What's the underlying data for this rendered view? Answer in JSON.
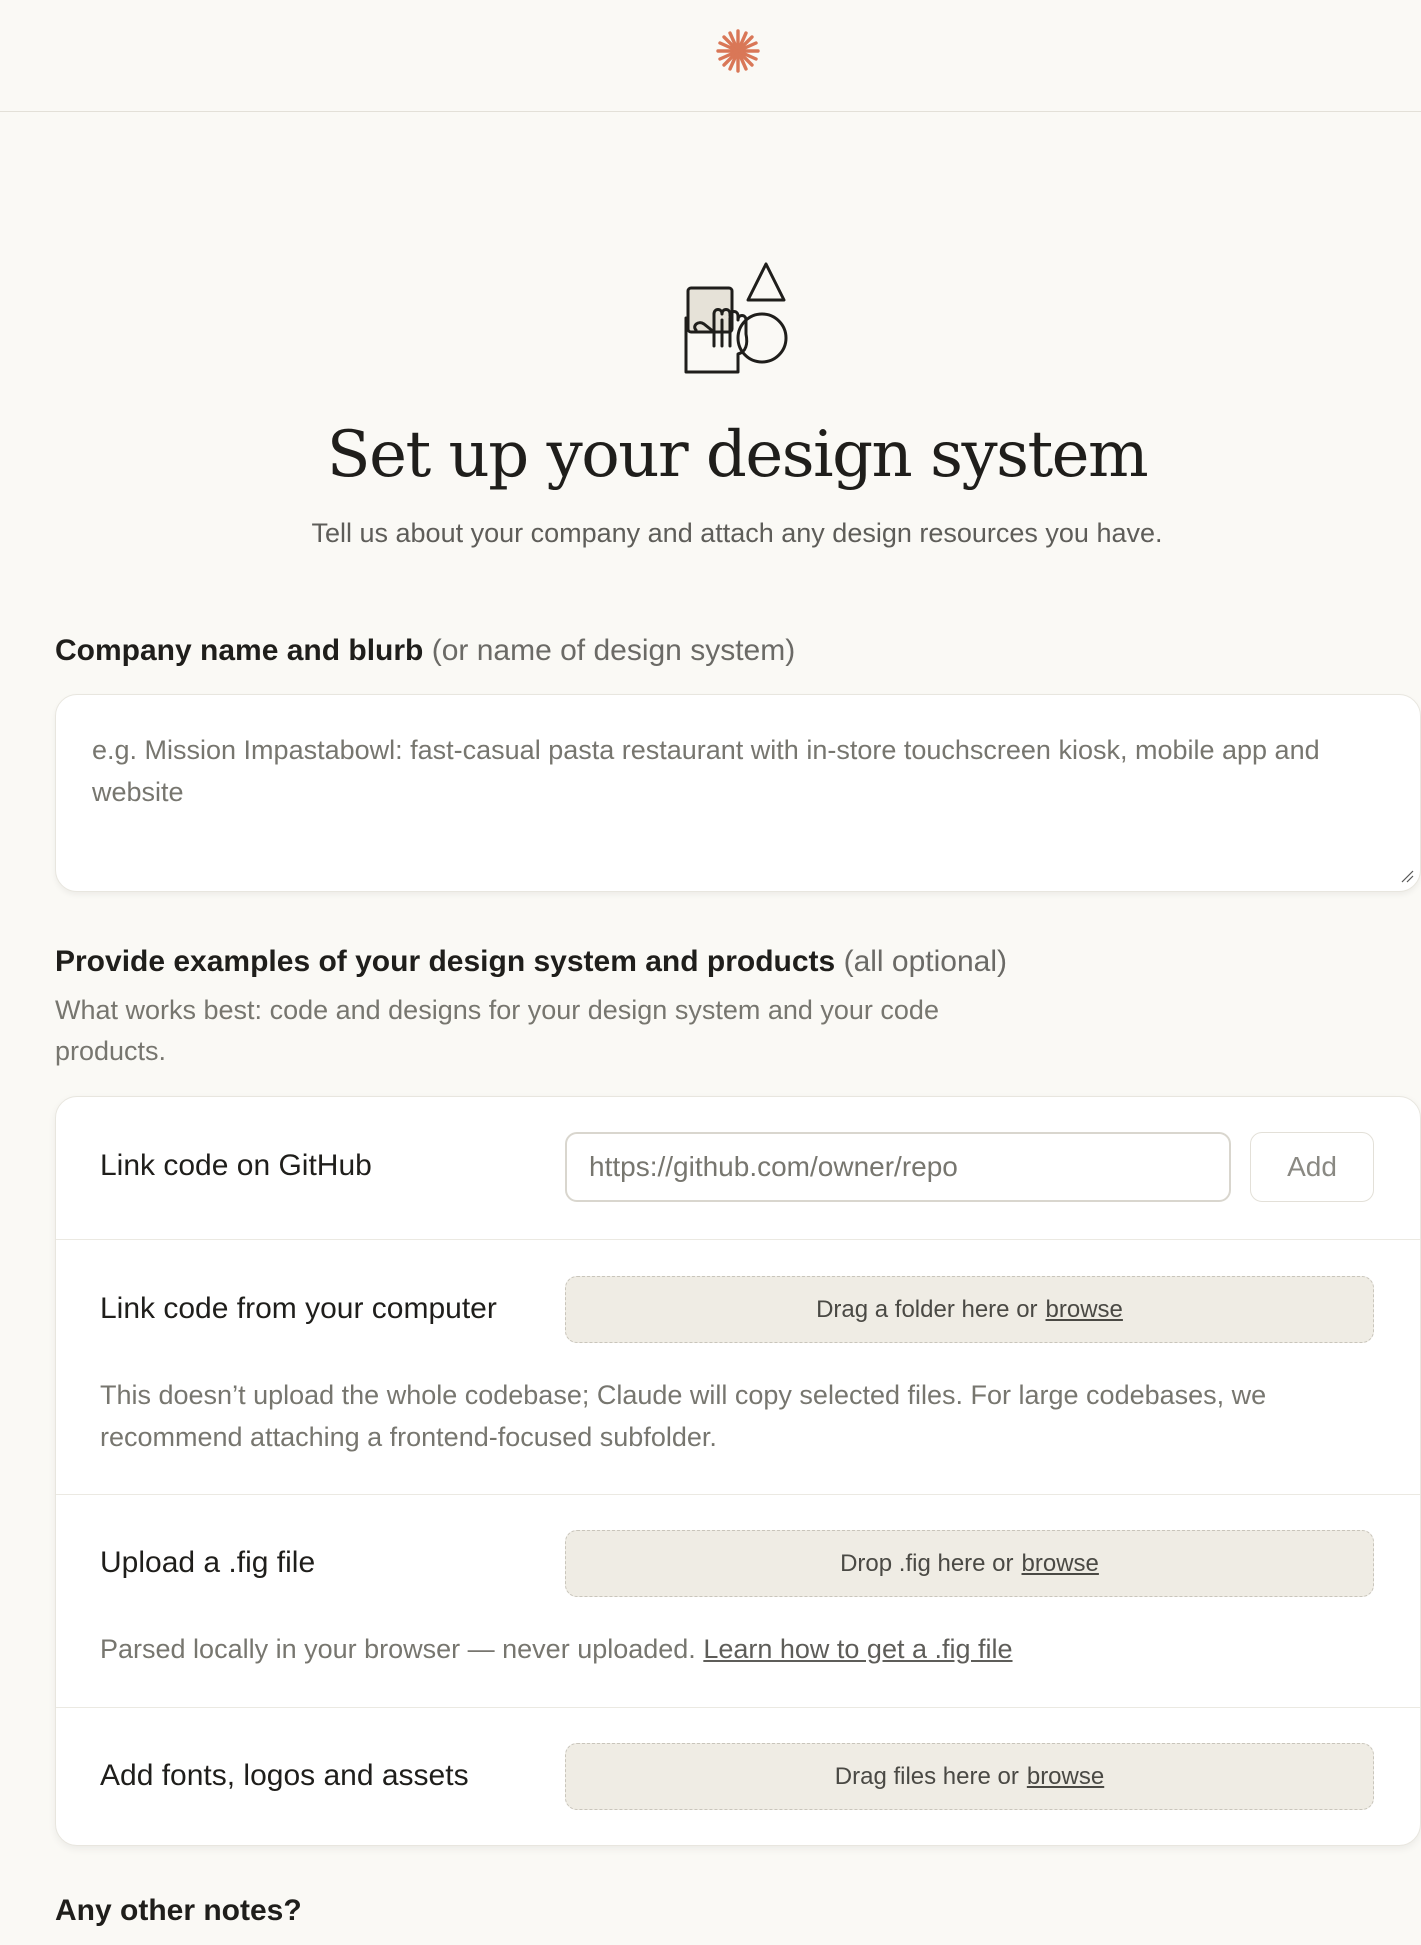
{
  "header": {
    "logo": "sparkle-logo-icon",
    "accent": "#d97757"
  },
  "hero": {
    "illustration": "hand-holding-shapes-icon",
    "title": "Set up your design system",
    "subtitle": "Tell us about your company and attach any design resources you have."
  },
  "company": {
    "label": "Company name and blurb",
    "label_hint": "(or name of design system)",
    "placeholder": "e.g. Mission Impastabowl: fast-casual pasta restaurant with in-store touchscreen kiosk, mobile app and website",
    "value": ""
  },
  "examples": {
    "label": "Provide examples of your design system and products",
    "label_hint": "(all optional)",
    "help": "What works best: code and designs for your design system and your code products.",
    "github": {
      "label": "Link code on GitHub",
      "placeholder": "https://github.com/owner/repo",
      "add_label": "Add"
    },
    "computer": {
      "label": "Link code from your computer",
      "drop_text": "Drag a folder here or",
      "browse": "browse",
      "note": "This doesn’t upload the whole codebase; Claude will copy selected files. For large codebases, we recommend attaching a frontend-focused subfolder."
    },
    "fig": {
      "label": "Upload a .fig file",
      "drop_text": "Drop .fig here or",
      "browse": "browse",
      "note": "Parsed locally in your browser — never uploaded.",
      "note_link": "Learn how to get a .fig file"
    },
    "assets": {
      "label": "Add fonts, logos and assets",
      "drop_text": "Drag files here or",
      "browse": "browse"
    }
  },
  "notes": {
    "label": "Any other notes?"
  }
}
